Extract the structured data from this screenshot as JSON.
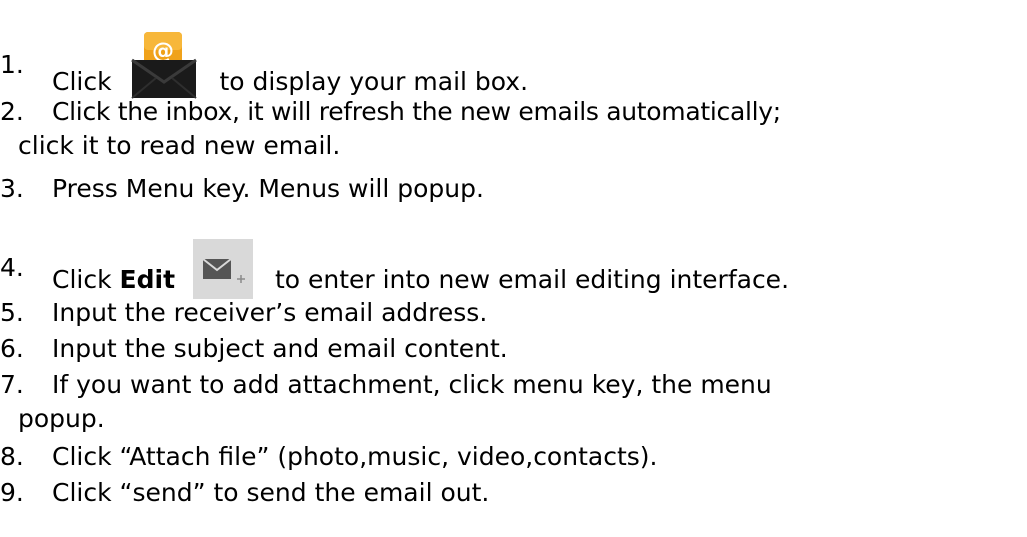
{
  "steps": [
    {
      "number": "1.",
      "before": "Click",
      "after": "to display your mail box.",
      "icon": "email-app-icon"
    },
    {
      "number": "2.",
      "line1": "Click the inbox, it will refresh the new emails automatically;",
      "line2": "click it to read new email."
    },
    {
      "number": "3.",
      "text": "Press Menu key. Menus will popup."
    },
    {
      "number": "4.",
      "before": "Click",
      "bold": "Edit",
      "after": "to enter into new email editing interface.",
      "icon": "compose-email-icon"
    },
    {
      "number": "5.",
      "text": "Input the receiver’s email address."
    },
    {
      "number": "6.",
      "text": "Input the subject and email content."
    },
    {
      "number": "7.",
      "line1": "If you want to add attachment, click menu key, the menu",
      "line2": "popup."
    },
    {
      "number": "8.",
      "text": "Click “Attach file” (photo,music, video,contacts)."
    },
    {
      "number": "9.",
      "text": "Click “send” to send the email out."
    }
  ],
  "colors": {
    "text": "#000000",
    "mail_icon_orange": "#f0a21a",
    "mail_icon_body": "#1a1a1a",
    "compose_icon_bg": "#d9d9d9",
    "compose_icon_fg": "#555555"
  }
}
